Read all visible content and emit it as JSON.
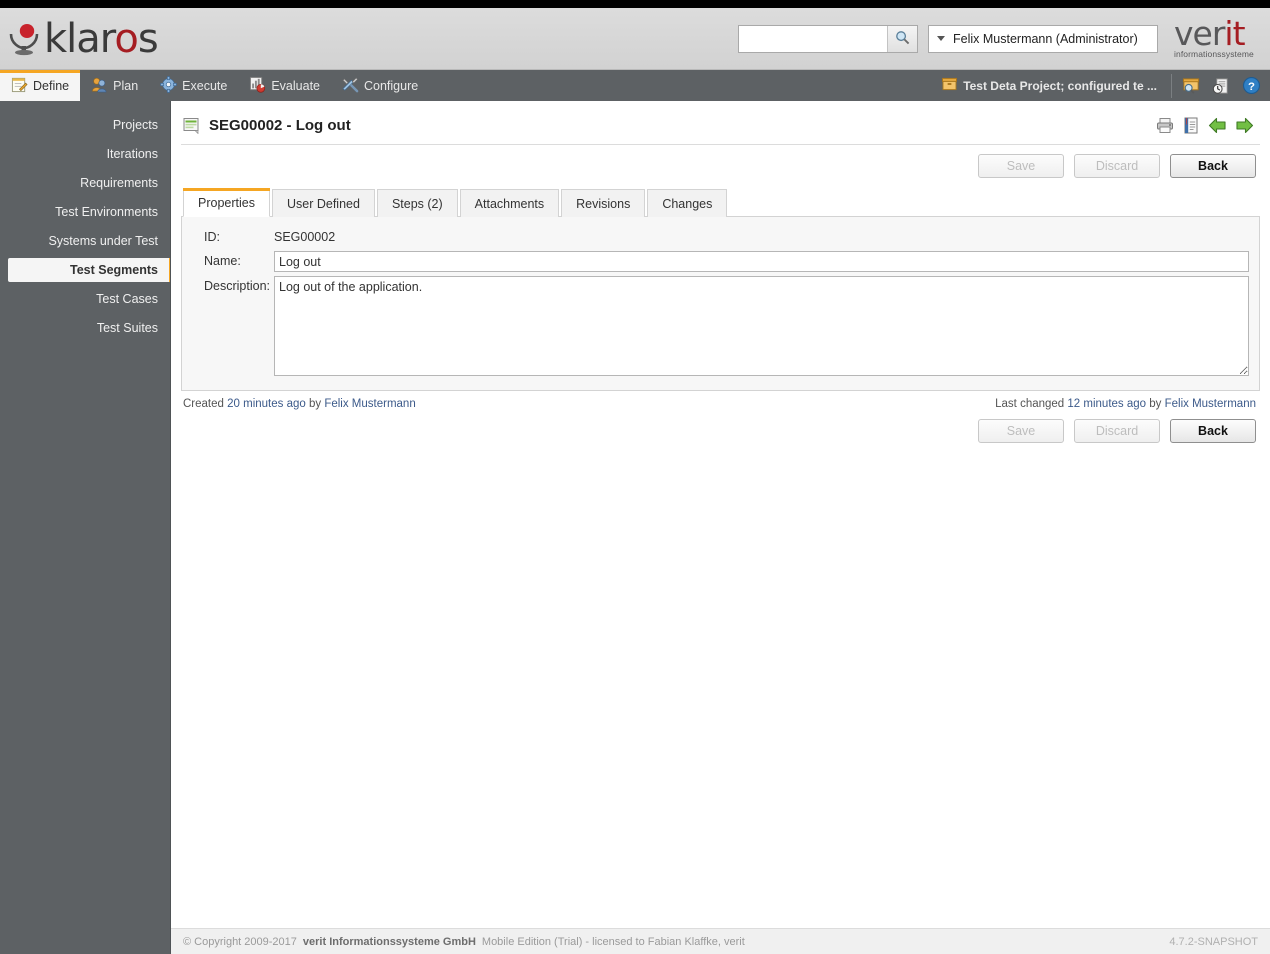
{
  "brand": {
    "name_part1": "klar",
    "name_o": "o",
    "name_part2": "s",
    "logo_icon": "klaros-logo-icon"
  },
  "header": {
    "search": {
      "value": "",
      "placeholder": ""
    },
    "user": {
      "label": "Felix Mustermann (Administrator)"
    },
    "company": {
      "line1_a": "ver",
      "line1_b": "it",
      "line2": "informationssysteme"
    }
  },
  "menu": {
    "items": [
      {
        "label": "Define",
        "icon": "define-notepad-icon",
        "active": true
      },
      {
        "label": "Plan",
        "icon": "plan-users-icon",
        "active": false
      },
      {
        "label": "Execute",
        "icon": "execute-gear-icon",
        "active": false
      },
      {
        "label": "Evaluate",
        "icon": "evaluate-chart-icon",
        "active": false
      },
      {
        "label": "Configure",
        "icon": "configure-tools-icon",
        "active": false
      }
    ],
    "project": {
      "label": "Test Deta Project; configured te ...",
      "icon": "project-box-icon"
    },
    "tools": [
      {
        "name": "search-project-icon"
      },
      {
        "name": "recent-items-icon"
      },
      {
        "name": "help-icon"
      }
    ]
  },
  "sidebar": {
    "items": [
      {
        "label": "Projects",
        "active": false
      },
      {
        "label": "Iterations",
        "active": false
      },
      {
        "label": "Requirements",
        "active": false
      },
      {
        "label": "Test Environments",
        "active": false
      },
      {
        "label": "Systems under Test",
        "active": false
      },
      {
        "label": "Test Segments",
        "active": true
      },
      {
        "label": "Test Cases",
        "active": false
      },
      {
        "label": "Test Suites",
        "active": false
      }
    ]
  },
  "page": {
    "title": "SEG00002 - Log out",
    "title_icon": "test-segment-icon",
    "actions": [
      {
        "name": "print-icon"
      },
      {
        "name": "report-icon"
      },
      {
        "name": "previous-arrow-icon"
      },
      {
        "name": "next-arrow-icon"
      }
    ]
  },
  "buttons": {
    "save": "Save",
    "discard": "Discard",
    "back": "Back"
  },
  "tabs": [
    {
      "label": "Properties",
      "active": true
    },
    {
      "label": "User Defined",
      "active": false
    },
    {
      "label": "Steps (2)",
      "active": false
    },
    {
      "label": "Attachments",
      "active": false
    },
    {
      "label": "Revisions",
      "active": false
    },
    {
      "label": "Changes",
      "active": false
    }
  ],
  "form": {
    "id_label": "ID:",
    "id_value": "SEG00002",
    "name_label": "Name:",
    "name_value": "Log out",
    "description_label": "Description:",
    "description_value": "Log out of the application."
  },
  "meta": {
    "created_prefix": "Created",
    "created_time": "20 minutes ago",
    "created_by_word": "by",
    "created_user": "Felix Mustermann",
    "changed_prefix": "Last changed",
    "changed_time": "12 minutes ago",
    "changed_by_word": "by",
    "changed_user": "Felix Mustermann"
  },
  "footer": {
    "copyright": "© Copyright 2009-2017",
    "company": "verit Informationssysteme GmbH",
    "license": "Mobile Edition (Trial) - licensed to Fabian Klaffke, verit",
    "version": "4.7.2-SNAPSHOT"
  },
  "colors": {
    "accent": "#f5a623",
    "chrome": "#5d6164",
    "brand_red": "#a51d22",
    "link": "#3c5a8a"
  }
}
